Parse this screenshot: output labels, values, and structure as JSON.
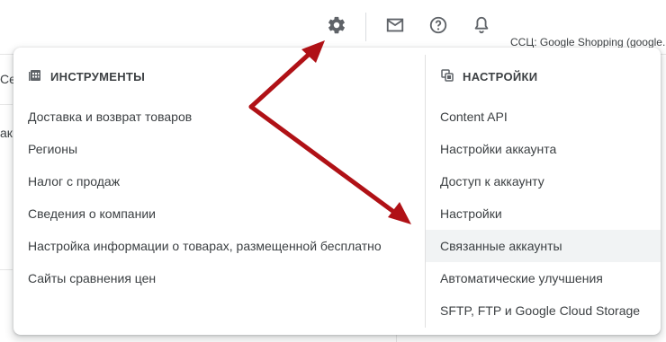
{
  "toolbar": {
    "settings_icon": "gear-icon",
    "mail_icon": "mail-icon",
    "help_icon": "help-icon",
    "notifications_icon": "bell-icon",
    "account_label": "ССЦ: Google Shopping (google."
  },
  "background": {
    "tab_fragment": "Се",
    "row_fragment": "ак"
  },
  "menu": {
    "tools": {
      "icon": "tools-grid-icon",
      "title": "ИНСТРУМЕНТЫ",
      "items": [
        "Доставка и возврат товаров",
        "Регионы",
        "Налог с продаж",
        "Сведения о компании",
        "Настройка информации о товарах, размещенной бесплатно",
        "Сайты сравнения цен"
      ]
    },
    "settings": {
      "icon": "settings-copy-icon",
      "title": "НАСТРОЙКИ",
      "items": [
        "Content API",
        "Настройки аккаунта",
        "Доступ к аккаунту",
        "Настройки",
        "Связанные аккаунты",
        "Автоматические улучшения",
        "SFTP, FTP и Google Cloud Storage"
      ],
      "active_index": 4
    }
  },
  "annotation": {
    "arrow_color": "#b01116"
  }
}
